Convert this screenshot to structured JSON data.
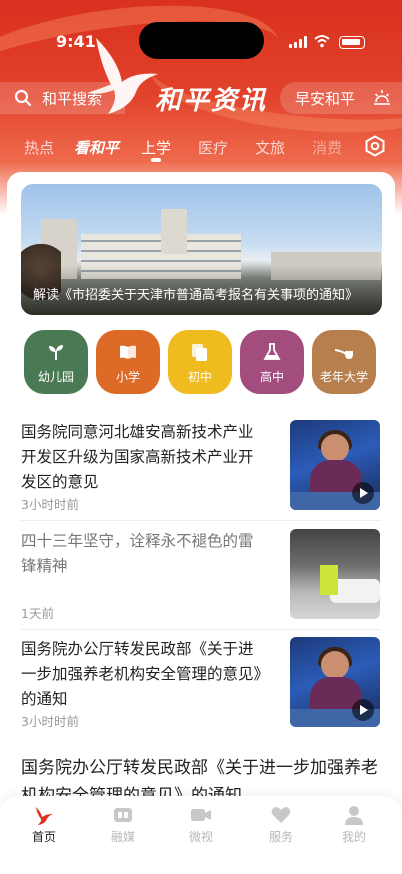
{
  "status_bar": {
    "time": "9:41"
  },
  "header": {
    "logo_text": "和平资讯",
    "search_placeholder": "和平搜索",
    "greeting": "早安和平",
    "brand_color": "#d9301f"
  },
  "tabs": [
    {
      "label": "热点",
      "state": "normal"
    },
    {
      "label": "看和平",
      "state": "bold"
    },
    {
      "label": "上学",
      "state": "active"
    },
    {
      "label": "医疗",
      "state": "normal"
    },
    {
      "label": "文旅",
      "state": "normal"
    },
    {
      "label": "消费",
      "state": "normal"
    }
  ],
  "banner": {
    "caption": "解读《市招委关于天津市普通高考报名有关事项的通知》"
  },
  "categories": [
    {
      "label": "幼儿园",
      "color": "#4a7a53",
      "icon": "sprout-icon"
    },
    {
      "label": "小学",
      "color": "#dd6a27",
      "icon": "book-icon"
    },
    {
      "label": "初中",
      "color": "#f0bb1f",
      "icon": "documents-icon"
    },
    {
      "label": "高中",
      "color": "#a34d7f",
      "icon": "flask-icon"
    },
    {
      "label": "老年大学",
      "color": "#b87f4e",
      "icon": "pipe-icon"
    }
  ],
  "news": [
    {
      "title": "国务院同意河北雄安高新技术产业开发区升级为国家高新技术产业开发区的意见",
      "time": "3小时时前",
      "thumb": "studio",
      "video": true,
      "read": false
    },
    {
      "title": "四十三年坚守，诠释永不褪色的雷锋精神",
      "time": "1天前",
      "thumb": "street",
      "video": false,
      "read": true
    },
    {
      "title": "国务院办公厅转发民政部《关于进一步加强养老机构安全管理的意见》的通知",
      "time": "3小时时前",
      "thumb": "studio",
      "video": true,
      "read": false
    }
  ],
  "big_news": {
    "title": "国务院办公厅转发民政部《关于进一步加强养老机构安全管理的意见》的通知"
  },
  "tabbar": [
    {
      "label": "首页",
      "icon": "home-dove-icon",
      "active": true
    },
    {
      "label": "融媒",
      "icon": "media-icon",
      "active": false
    },
    {
      "label": "微视",
      "icon": "video-camera-icon",
      "active": false
    },
    {
      "label": "服务",
      "icon": "heart-icon",
      "active": false
    },
    {
      "label": "我的",
      "icon": "user-icon",
      "active": false
    }
  ]
}
